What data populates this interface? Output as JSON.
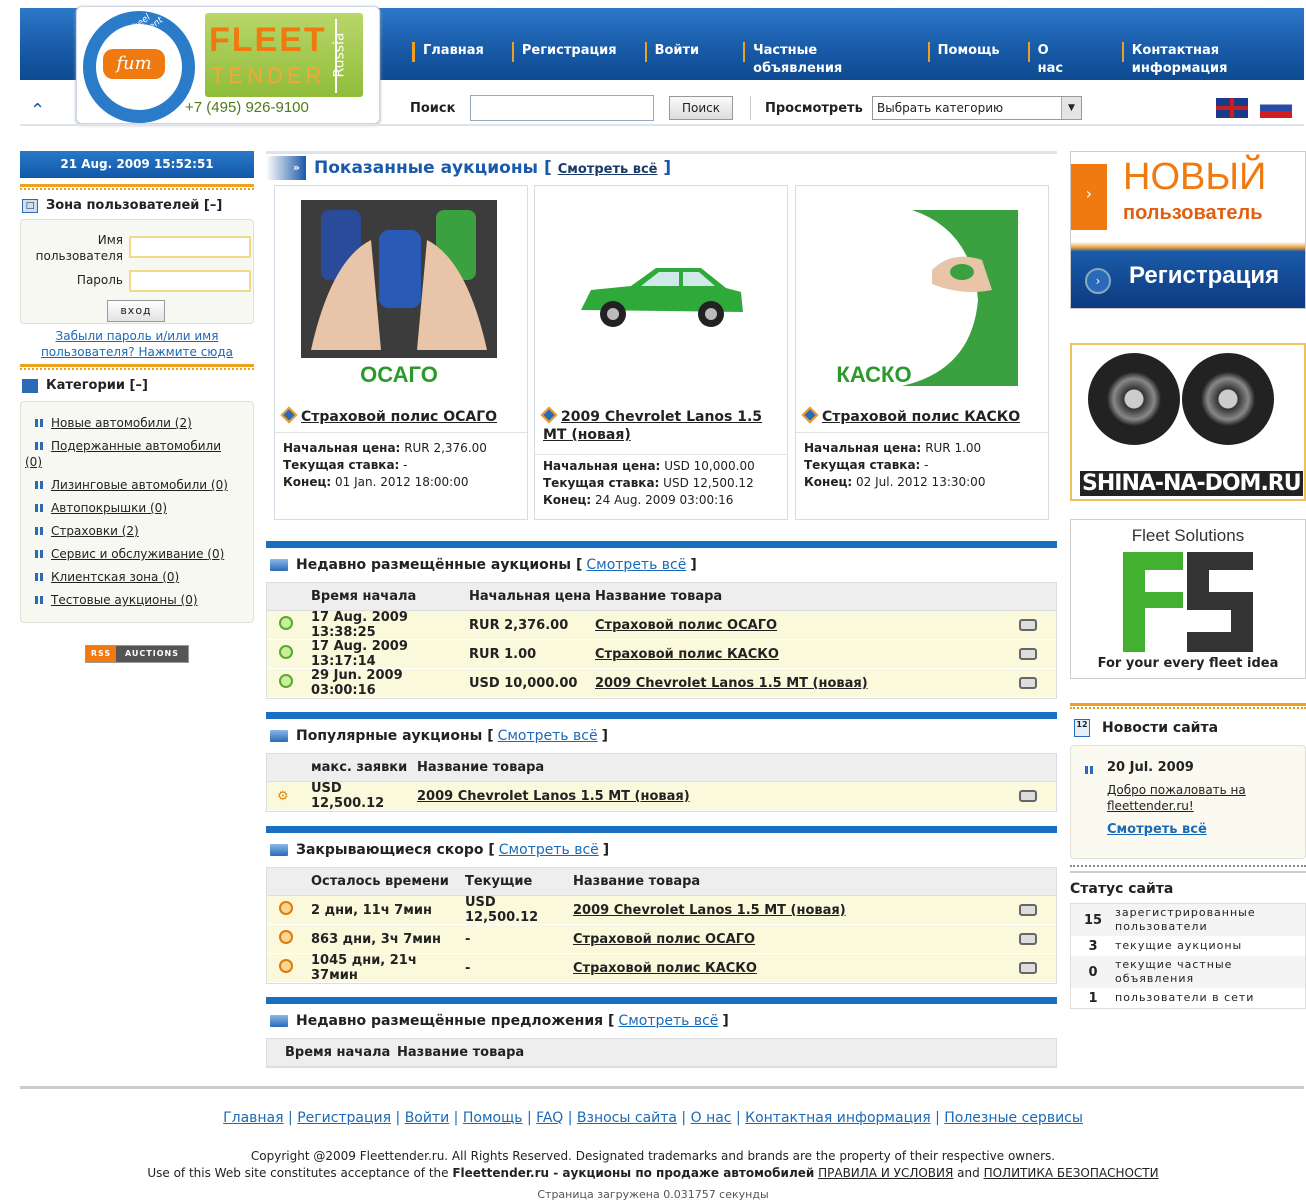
{
  "header": {
    "logo": {
      "ring_text": "Fifth Wheel Management",
      "badge": "fum",
      "brand_main": "FLEET",
      "brand_sub": "TENDER",
      "country": "Russia",
      "phone": "+7 (495) 926-9100"
    },
    "nav": [
      "Главная",
      "Регистрация",
      "Войти",
      "Частные объявления",
      "Помощь",
      "О нас",
      "Контактная информация"
    ],
    "search": {
      "label": "Поиск",
      "value": "",
      "button": "Поиск"
    },
    "view": {
      "label": "Просмотреть",
      "selected": "Выбрать категорию"
    }
  },
  "left": {
    "datetime": "21 Aug. 2009 15:52:51",
    "user_zone": {
      "title": "Зона пользователей [–]",
      "username_label_1": "Имя",
      "username_label_2": "пользователя",
      "password_label": "Пароль",
      "login_button": "вход",
      "forgot_1": "Забыли пароль и/или имя",
      "forgot_2": "пользователя? Нажмите сюда"
    },
    "categories_title": "Категории [–]",
    "categories": [
      {
        "name": "Новые автомобили",
        "count": "(2)"
      },
      {
        "name": "Подержанные автомобили",
        "count": "(0)"
      },
      {
        "name": "Лизинговые автомобили",
        "count": "(0)"
      },
      {
        "name": "Автопокрышки",
        "count": "(0)"
      },
      {
        "name": "Страховки",
        "count": "(2)"
      },
      {
        "name": "Сервис и обслуживание",
        "count": "(0)"
      },
      {
        "name": "Клиентская зона",
        "count": "(0)"
      },
      {
        "name": "Тестовые аукционы",
        "count": "(0)"
      }
    ],
    "rss": {
      "left": "RSS",
      "right": "AUCTIONS"
    }
  },
  "featured": {
    "title": "Показанные аукционы",
    "view_all": "Смотреть всё",
    "items": [
      {
        "image_caption": "ОСАГО",
        "title": "Страховой полис ОСАГО",
        "start_label": "Начальная цена:",
        "start": "RUR 2,376.00",
        "bid_label": "Текущая ставка:",
        "bid": "-",
        "end_label": "Конец:",
        "end": "01 Jan. 2012 18:00:00"
      },
      {
        "image_caption": "",
        "title": "2009 Chevrolet Lanos 1.5 MT (новая)",
        "start_label": "Начальная цена:",
        "start": "USD 10,000.00",
        "bid_label": "Текущая ставка:",
        "bid": "USD 12,500.12",
        "end_label": "Конец:",
        "end": "24 Aug. 2009 03:00:16"
      },
      {
        "image_caption": "КАСКО",
        "title": "Страховой полис КАСКО",
        "start_label": "Начальная цена:",
        "start": "RUR 1.00",
        "bid_label": "Текущая ставка:",
        "bid": "-",
        "end_label": "Конец:",
        "end": "02 Jul. 2012 13:30:00"
      }
    ]
  },
  "recent": {
    "title": "Недавно размещённые аукционы [",
    "view_all": "Смотреть всё",
    "close": "]",
    "columns": [
      "Время начала",
      "Начальная цена",
      "Название товара"
    ],
    "rows": [
      {
        "time": "17 Aug. 2009 13:38:25",
        "price": "RUR 2,376.00",
        "name": "Страховой полис ОСАГО"
      },
      {
        "time": "17 Aug. 2009 13:17:14",
        "price": "RUR 1.00",
        "name": "Страховой полис КАСКО"
      },
      {
        "time": "29 Jun. 2009 03:00:16",
        "price": "USD 10,000.00",
        "name": "2009 Chevrolet Lanos 1.5 MT (новая)"
      }
    ]
  },
  "popular": {
    "title": "Популярные аукционы [",
    "view_all": "Смотреть всё",
    "close": "]",
    "columns": [
      "макс. заявки",
      "Название товара"
    ],
    "rows": [
      {
        "bid": "USD 12,500.12",
        "name": "2009 Chevrolet Lanos 1.5 MT (новая)"
      }
    ]
  },
  "closing": {
    "title": "Закрывающиеся скоро [",
    "view_all": "Смотреть всё",
    "close": "]",
    "columns": [
      "Осталось времени",
      "Текущие",
      "Название товара"
    ],
    "rows": [
      {
        "left": "2 дни, 11ч 7мин",
        "current": "USD 12,500.12",
        "name": "2009 Chevrolet Lanos 1.5 MT (новая)"
      },
      {
        "left": "863 дни, 3ч 7мин",
        "current": "-",
        "name": "Страховой полис ОСАГО"
      },
      {
        "left": "1045 дни, 21ч 37мин",
        "current": "-",
        "name": "Страховой полис КАСКО"
      }
    ]
  },
  "offers": {
    "title": "Недавно размещённые предложения [",
    "view_all": "Смотреть всё",
    "close": "]",
    "columns": [
      "Время начала",
      "Название товара"
    ]
  },
  "right": {
    "new_user": {
      "line1": "НОВЫЙ",
      "line2": "пользователь",
      "button": "Регистрация"
    },
    "shina": "SHINA-NA-DOM.RU",
    "fs": {
      "title": "Fleet Solutions",
      "tagline": "For your every fleet idea"
    },
    "news": {
      "title": "Новости сайта",
      "date": "20 Jul. 2009",
      "text_1": "Добро пожаловать на",
      "text_2": "fleettender.ru!",
      "view_all": "Смотреть всё"
    },
    "status": {
      "title": "Статус сайта",
      "rows": [
        {
          "n": "15",
          "label_1": "зарегистрированные",
          "label_2": "пользователи"
        },
        {
          "n": "3",
          "label_1": "текущие аукционы",
          "label_2": ""
        },
        {
          "n": "0",
          "label_1": "текущие частные",
          "label_2": "объявления"
        },
        {
          "n": "1",
          "label_1": "пользователи в сети",
          "label_2": ""
        }
      ]
    }
  },
  "footer": {
    "links": [
      "Главная",
      "Регистрация",
      "Войти",
      "Помощь",
      "FAQ",
      "Взносы сайта",
      "О нас",
      "Контактная информация",
      "Полезные сервисы"
    ],
    "copyright": "Copyright @2009 Fleettender.ru. All Rights Reserved. Designated trademarks and brands are the property of their respective owners.",
    "use_1": "Use of this Web site constitutes acceptance of the",
    "use_brand": "Fleettender.ru - аукционы по продаже автомобилей",
    "rules": "ПРАВИЛА И УСЛОВИЯ",
    "and": "and",
    "privacy": "ПОЛИТИКА БЕЗОПАСНОСТИ",
    "loaded": "Страница загружена 0.031757 секунды"
  }
}
